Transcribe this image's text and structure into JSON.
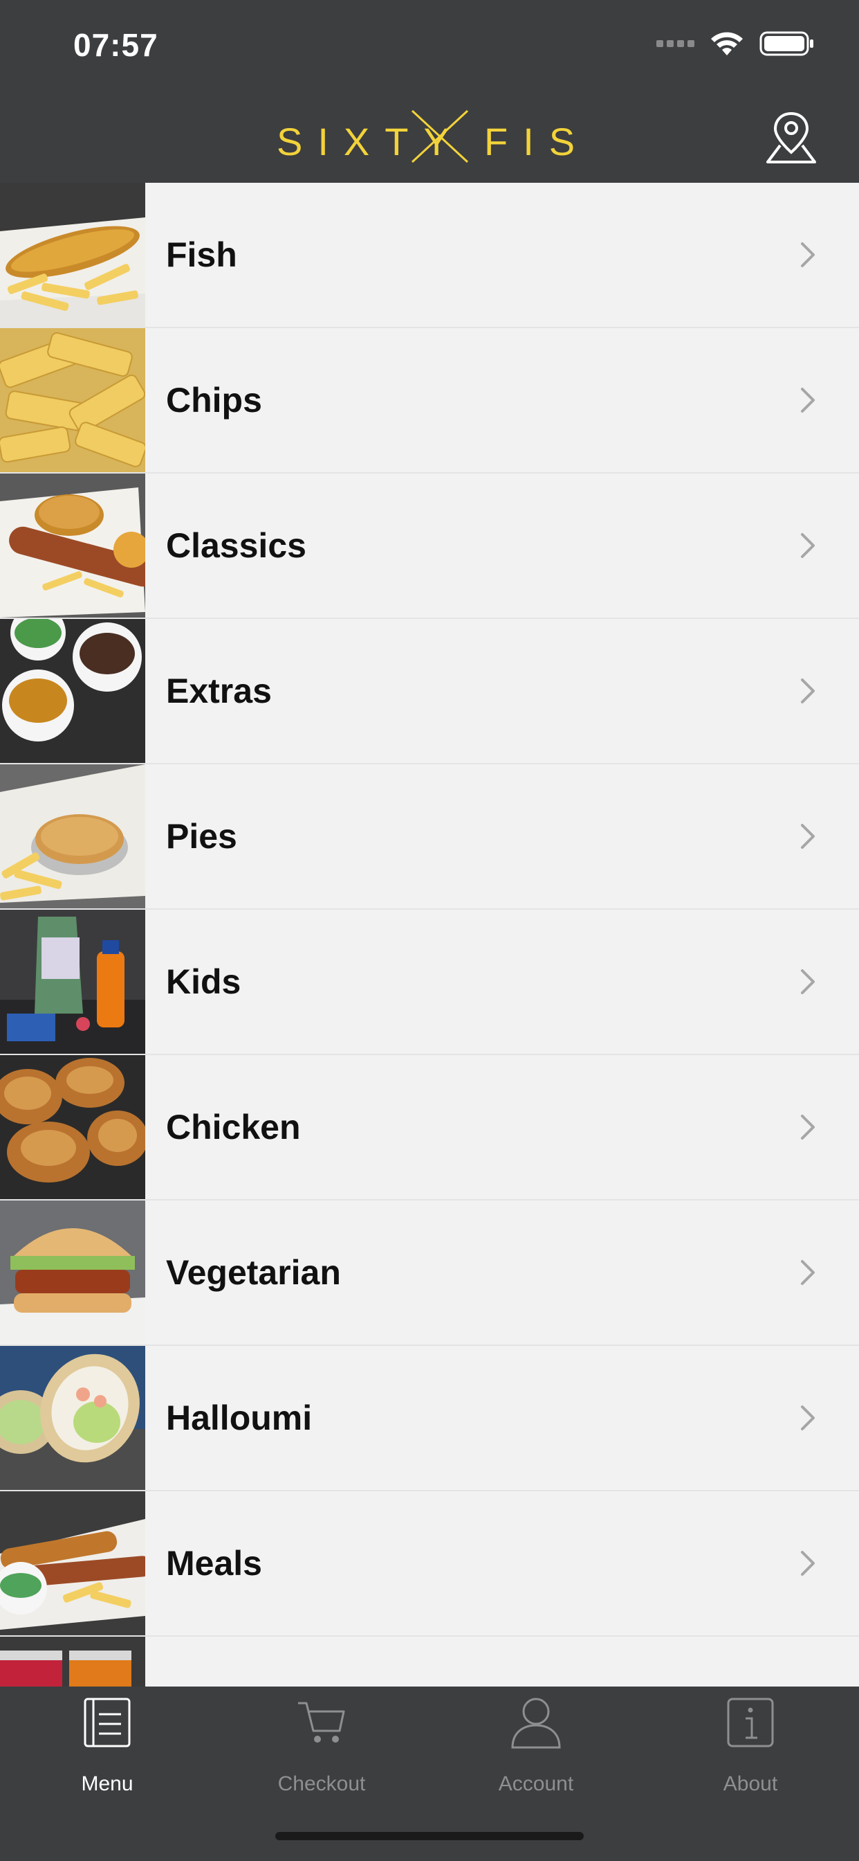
{
  "status_bar": {
    "time": "07:57"
  },
  "header": {
    "brand_left": "SIXTY",
    "brand_right": "FISH"
  },
  "menu": {
    "items": [
      {
        "label": "Fish",
        "thumb": "fish-and-chips"
      },
      {
        "label": "Chips",
        "thumb": "chips"
      },
      {
        "label": "Classics",
        "thumb": "sausage-and-chips"
      },
      {
        "label": "Extras",
        "thumb": "sauce-pots"
      },
      {
        "label": "Pies",
        "thumb": "pie-and-chips"
      },
      {
        "label": "Kids",
        "thumb": "kids-meal"
      },
      {
        "label": "Chicken",
        "thumb": "fried-chicken"
      },
      {
        "label": "Vegetarian",
        "thumb": "veggie-burger"
      },
      {
        "label": "Halloumi",
        "thumb": "halloumi-wrap"
      },
      {
        "label": "Meals",
        "thumb": "meal-tray"
      },
      {
        "label": "",
        "thumb": "drinks"
      }
    ]
  },
  "tabs": [
    {
      "label": "Menu",
      "icon": "menu-icon",
      "active": true
    },
    {
      "label": "Checkout",
      "icon": "cart-icon",
      "active": false
    },
    {
      "label": "Account",
      "icon": "person-icon",
      "active": false
    },
    {
      "label": "About",
      "icon": "info-icon",
      "active": false
    }
  ],
  "colors": {
    "bar_background": "#3d3e40",
    "brand_yellow": "#f2d33a",
    "list_background": "#f2f2f2",
    "tab_active": "#ffffff",
    "tab_inactive": "#8e8f91"
  }
}
